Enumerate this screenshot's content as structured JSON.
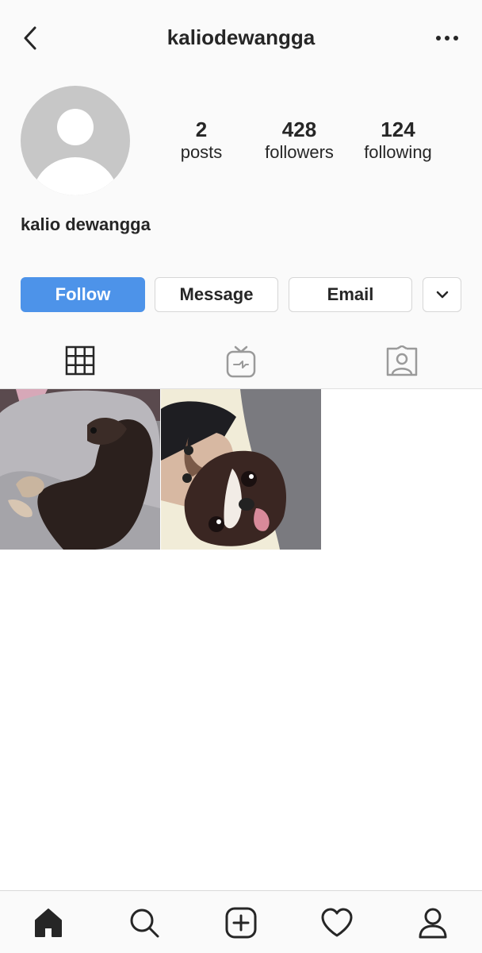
{
  "header": {
    "username": "kaliodewangga",
    "back_icon": "chevron-left-icon",
    "more_icon": "more-horizontal-icon"
  },
  "profile": {
    "full_name": "kalio dewangga",
    "stats": [
      {
        "value": "2",
        "label": "posts"
      },
      {
        "value": "428",
        "label": "followers"
      },
      {
        "value": "124",
        "label": "following"
      }
    ]
  },
  "actions": {
    "follow_label": "Follow",
    "message_label": "Message",
    "email_label": "Email"
  },
  "tabs": [
    {
      "name": "grid",
      "icon": "grid-icon",
      "active": true
    },
    {
      "name": "igtv",
      "icon": "igtv-icon",
      "active": false
    },
    {
      "name": "tagged",
      "icon": "tagged-user-icon",
      "active": false
    }
  ],
  "posts": [
    {
      "description_icon": "photo-dog-sleeping"
    },
    {
      "description_icon": "photo-selfie-with-dog"
    }
  ],
  "bottom_nav": [
    {
      "name": "home",
      "icon": "home-icon",
      "active": true
    },
    {
      "name": "search",
      "icon": "search-icon",
      "active": false
    },
    {
      "name": "new-post",
      "icon": "plus-square-icon",
      "active": false
    },
    {
      "name": "activity",
      "icon": "heart-icon",
      "active": false
    },
    {
      "name": "profile",
      "icon": "user-icon",
      "active": false
    }
  ],
  "colors": {
    "accent": "#4d93e9",
    "text": "#262626",
    "avatar_bg": "#c7c7c7",
    "header_bg": "#fafafa"
  }
}
